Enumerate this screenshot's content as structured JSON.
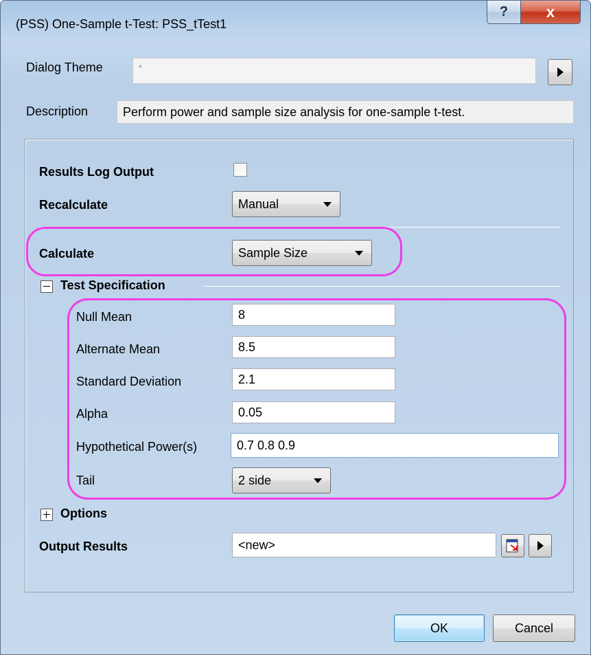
{
  "window": {
    "title": "(PSS) One-Sample t-Test: PSS_tTest1",
    "help_label": "?",
    "close_label": "x"
  },
  "theme": {
    "label": "Dialog Theme",
    "value": "*"
  },
  "description": {
    "label": "Description",
    "text": "Perform power and sample size analysis for one-sample t-test."
  },
  "settings": {
    "results_log_label": "Results Log Output",
    "results_log_checked": false,
    "recalculate_label": "Recalculate",
    "recalculate_value": "Manual",
    "calculate_label": "Calculate",
    "calculate_value": "Sample Size"
  },
  "test_spec": {
    "header": "Test Specification",
    "expanded": true,
    "null_mean_label": "Null Mean",
    "null_mean_value": "8",
    "alt_mean_label": "Alternate Mean",
    "alt_mean_value": "8.5",
    "std_dev_label": "Standard Deviation",
    "std_dev_value": "2.1",
    "alpha_label": "Alpha",
    "alpha_value": "0.05",
    "power_label": "Hypothetical Power(s)",
    "power_value": "0.7 0.8 0.9",
    "tail_label": "Tail",
    "tail_value": "2 side"
  },
  "options": {
    "header": "Options",
    "expanded": false
  },
  "output": {
    "label": "Output Results",
    "value": "<new>"
  },
  "buttons": {
    "ok": "OK",
    "cancel": "Cancel"
  },
  "colors": {
    "highlight": "#ee3ee6",
    "dialog_bg": "#f0f0f0",
    "frame": "#b9d0e8"
  }
}
